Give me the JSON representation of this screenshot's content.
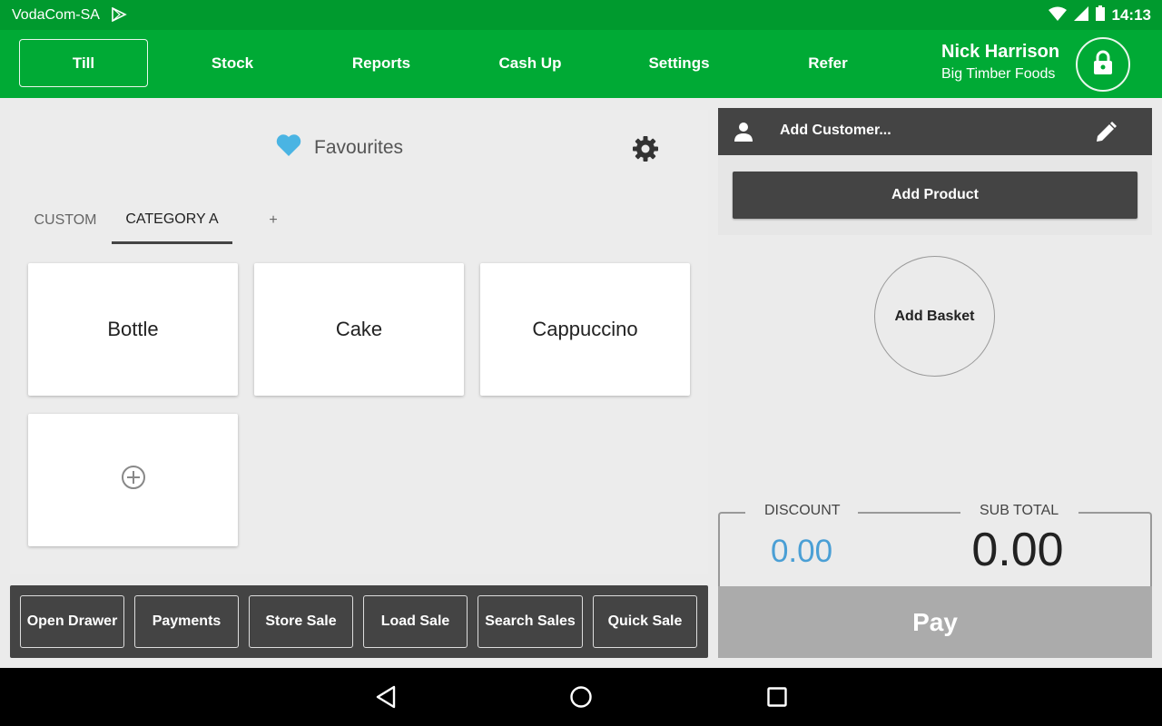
{
  "status_bar": {
    "carrier": "VodaCom-SA",
    "time": "14:13"
  },
  "nav": {
    "tabs": [
      {
        "label": "Till",
        "active": true
      },
      {
        "label": "Stock"
      },
      {
        "label": "Reports"
      },
      {
        "label": "Cash Up"
      },
      {
        "label": "Settings"
      },
      {
        "label": "Refer"
      }
    ],
    "user_name": "Nick Harrison",
    "company": "Big Timber Foods"
  },
  "favourites": {
    "title": "Favourites",
    "tabs": [
      {
        "label": "CUSTOM"
      },
      {
        "label": "CATEGORY A",
        "active": true
      },
      {
        "label": "+"
      }
    ],
    "products": [
      {
        "label": "Bottle"
      },
      {
        "label": "Cake"
      },
      {
        "label": "Cappuccino"
      }
    ]
  },
  "actions": [
    "Open Drawer",
    "Payments",
    "Store Sale",
    "Load Sale",
    "Search Sales",
    "Quick Sale"
  ],
  "sale": {
    "customer_placeholder": "Add Customer...",
    "add_product": "Add Product",
    "add_basket": "Add Basket",
    "discount_label": "DISCOUNT",
    "discount_value": "0.00",
    "subtotal_label": "SUB TOTAL",
    "subtotal_value": "0.00",
    "pay": "Pay"
  },
  "colors": {
    "brand_green": "#00aa35",
    "status_green": "#009a2e",
    "dark": "#444444",
    "discount_blue": "#4a9fd5",
    "heart": "#4ab4e3"
  }
}
